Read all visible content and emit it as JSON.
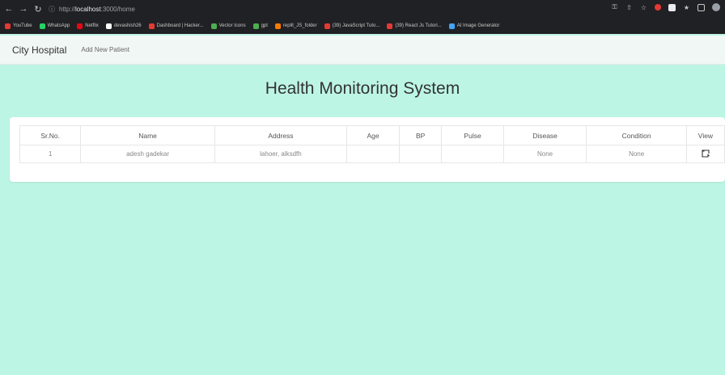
{
  "browser": {
    "url_prefix": "http://",
    "url_host": "localhost",
    "url_path": ":3000/home",
    "bookmarks": [
      {
        "label": "YouTube",
        "color": "#e53935"
      },
      {
        "label": "WhatsApp",
        "color": "#25d366"
      },
      {
        "label": "Netflix",
        "color": "#e50914"
      },
      {
        "label": "devashish26",
        "color": "#ffffff"
      },
      {
        "label": "Dashboard | Hacker...",
        "color": "#e53935"
      },
      {
        "label": "Vector Icons",
        "color": "#4caf50"
      },
      {
        "label": "gpt",
        "color": "#4caf50"
      },
      {
        "label": "replit_JS_folder",
        "color": "#f57c00"
      },
      {
        "label": "(39) JavaScript Tuto...",
        "color": "#e53935"
      },
      {
        "label": "(39) React Js Tutori...",
        "color": "#e53935"
      },
      {
        "label": "AI Image Generator",
        "color": "#42a5f5"
      }
    ]
  },
  "navbar": {
    "brand": "City Hospital",
    "links": [
      "Add New Patient"
    ]
  },
  "main": {
    "title": "Health Monitoring System",
    "table": {
      "headers": [
        "Sr.No.",
        "Name",
        "Address",
        "Age",
        "BP",
        "Pulse",
        "Disease",
        "Condition",
        "View"
      ],
      "rows": [
        {
          "sr": "1",
          "name": "adesh gadekar",
          "address": "lahoer, alksdfh",
          "age": "",
          "bp": "",
          "pulse": "",
          "disease": "None",
          "condition": "None",
          "view_icon": "external-view-icon"
        }
      ]
    }
  }
}
